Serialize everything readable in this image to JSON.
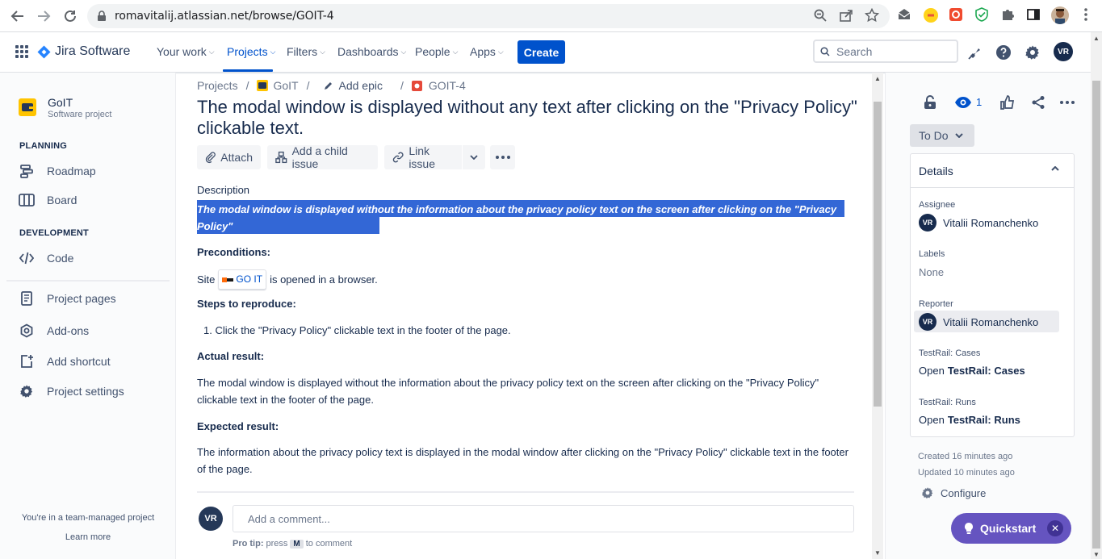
{
  "browser": {
    "url": "romavitalij.atlassian.net/browse/GOIT-4"
  },
  "topnav": {
    "product": "Jira Software",
    "items": [
      {
        "label": "Your work"
      },
      {
        "label": "Projects"
      },
      {
        "label": "Filters"
      },
      {
        "label": "Dashboards"
      },
      {
        "label": "People"
      },
      {
        "label": "Apps"
      }
    ],
    "create_label": "Create",
    "search_placeholder": "Search",
    "user_initials": "VR",
    "accent": "#0052cc"
  },
  "sidebar": {
    "project_name": "GoIT",
    "project_type": "Software project",
    "planning_heading": "PLANNING",
    "development_heading": "DEVELOPMENT",
    "items": [
      {
        "label": "Roadmap",
        "icon": "roadmap-icon"
      },
      {
        "label": "Board",
        "icon": "board-icon"
      },
      {
        "label": "Code",
        "icon": "code-icon"
      },
      {
        "label": "Project pages",
        "icon": "page-icon"
      },
      {
        "label": "Add-ons",
        "icon": "addons-icon"
      },
      {
        "label": "Add shortcut",
        "icon": "add-shortcut-icon"
      },
      {
        "label": "Project settings",
        "icon": "gear-icon"
      }
    ],
    "team_managed": "You're in a team-managed project",
    "learn_more": "Learn more"
  },
  "breadcrumbs": {
    "projects": "Projects",
    "project": "GoIT",
    "epic": "Add epic",
    "issue": "GOIT-4"
  },
  "issue": {
    "title": "The modal window is displayed without any text after clicking on the \"Privacy Policy\" clickable text.",
    "toolbar": {
      "attach": "Attach",
      "add_child": "Add a child issue",
      "link_issue": "Link issue"
    },
    "description_label": "Description",
    "description_line1": "The modal window is displayed without the information about the privacy policy text on the screen after clicking on the \"Privacy Policy\"",
    "description_line2": "clickable text in the footer of the page.",
    "preconditions_head": "Preconditions:",
    "site_prefix": "Site",
    "site_chip": "GO IT",
    "site_suffix": "is opened in a browser.",
    "steps_head": "Steps to reproduce:",
    "step_1": "Click the \"Privacy Policy\" clickable text in the footer of the page.",
    "actual_head": "Actual result:",
    "actual_text": "The modal window is displayed without the information about the privacy policy text on the screen after clicking on the \"Privacy Policy\" clickable text in the footer of the page.",
    "expected_head": "Expected result:",
    "expected_text": "The information about the privacy policy text is displayed in the modal window after clicking on the \"Privacy Policy\" clickable text in the footer of the page.",
    "comment_placeholder": "Add a comment...",
    "commenter_initials": "VR",
    "protip_label": "Pro tip:",
    "protip_press": "press",
    "protip_key": "M",
    "protip_suffix": "to comment"
  },
  "rightpanel": {
    "watch_count": "1",
    "status": "To Do",
    "details_title": "Details",
    "assignee_label": "Assignee",
    "assignee_name": "Vitalii Romanchenko",
    "assignee_initials": "VR",
    "labels_label": "Labels",
    "labels_value": "None",
    "reporter_label": "Reporter",
    "reporter_name": "Vitalii Romanchenko",
    "reporter_initials": "VR",
    "testrail_cases_label": "TestRail: Cases",
    "testrail_cases_open": "Open",
    "testrail_cases_value": "TestRail: Cases",
    "testrail_runs_label": "TestRail: Runs",
    "testrail_runs_open": "Open",
    "testrail_runs_value": "TestRail: Runs",
    "created": "Created 16 minutes ago",
    "updated": "Updated 10 minutes ago",
    "configure": "Configure",
    "quickstart": "Quickstart"
  }
}
